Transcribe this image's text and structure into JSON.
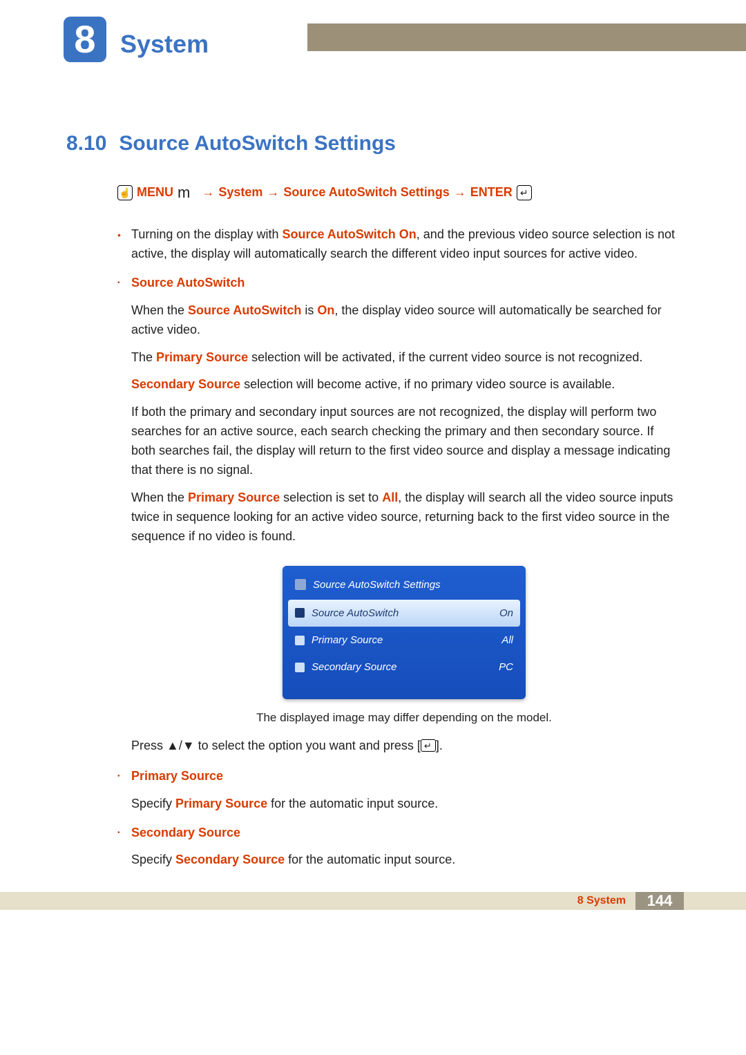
{
  "chapter": {
    "number": "8",
    "title": "System"
  },
  "section": {
    "number": "8.10",
    "title": "Source AutoSwitch Settings"
  },
  "nav": {
    "menu_label": "MENU",
    "m_glyph": "m",
    "arrow": "→",
    "path1": "System",
    "path2": "Source AutoSwitch Settings",
    "enter_label": "ENTER"
  },
  "intro": {
    "pre": "Turning on the display with ",
    "bold": "Source AutoSwitch On",
    "post": ", and the previous video source selection is not active, the display will automatically search the different video input sources for active video."
  },
  "sourceAuto": {
    "heading": "Source AutoSwitch",
    "p1_pre": "When the ",
    "p1_b1": "Source AutoSwitch",
    "p1_mid": " is ",
    "p1_b2": "On",
    "p1_post": ", the display video source will automatically be searched for active video.",
    "p2_pre": "The ",
    "p2_b": "Primary Source",
    "p2_post": " selection will be activated, if the current video source is not recognized.",
    "p3_b": "Secondary Source",
    "p3_post": " selection will become active, if no primary video source is available.",
    "p4": "If both the primary and secondary input sources are not recognized, the display will perform two searches for an active source, each search checking the primary and then secondary source. If both searches fail, the display will return to the first video source and display a message indicating that there is no signal.",
    "p5_pre": "When the ",
    "p5_b1": "Primary Source",
    "p5_mid": " selection is set to ",
    "p5_b2": "All",
    "p5_post": ", the display will search all the video source inputs twice in sequence looking for an active video source, returning back to the first video source in the sequence if no video is found."
  },
  "osd": {
    "heading": "Source AutoSwitch Settings",
    "rows": [
      {
        "label": "Source AutoSwitch",
        "value": "On",
        "selected": true
      },
      {
        "label": "Primary Source",
        "value": "All",
        "selected": false
      },
      {
        "label": "Secondary Source",
        "value": "PC",
        "selected": false
      }
    ],
    "caption": "The displayed image may differ depending on the model.",
    "press_pre": "Press  ",
    "press_udglyph": "▲/▼",
    "press_mid": " to select the option you want and press [",
    "press_post": "]."
  },
  "primary": {
    "heading": "Primary Source",
    "text_pre": "Specify ",
    "text_b": "Primary Source",
    "text_post": " for the automatic input source."
  },
  "secondary": {
    "heading": "Secondary Source",
    "text_pre": "Specify ",
    "text_b": "Secondary Source",
    "text_post": " for the automatic input source."
  },
  "footer": {
    "chapter_ref": "8 System",
    "page": "144"
  }
}
